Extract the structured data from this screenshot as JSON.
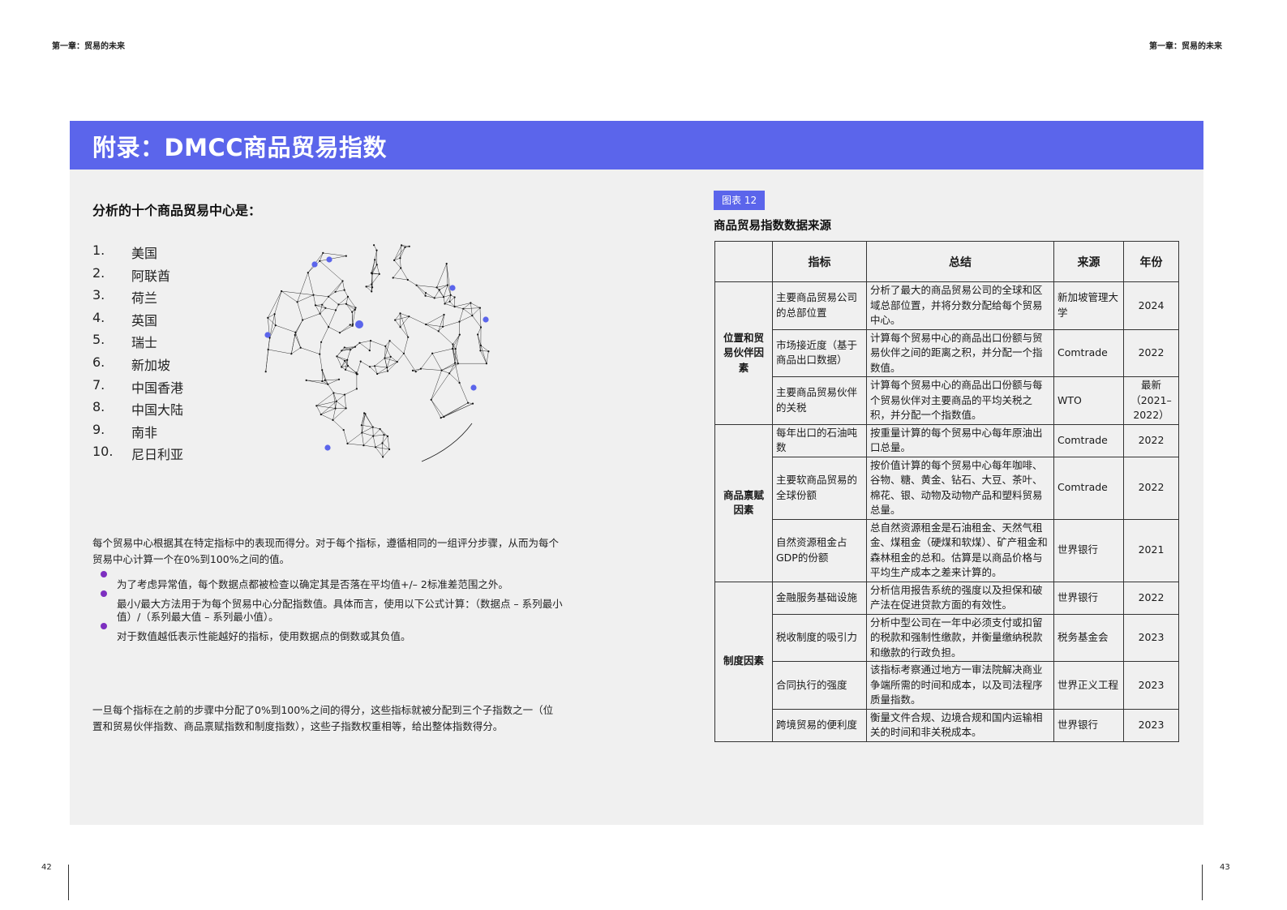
{
  "header": {
    "left_running": "第一章：贸易的未来",
    "right_running": "第一章：贸易的未来"
  },
  "banner": {
    "title": "附录：DMCC商品贸易指数"
  },
  "colors": {
    "accent": "#5b65eb",
    "bullet": "#7d2fc0",
    "panel": "#f0f0f0"
  },
  "left": {
    "subheading": "分析的十个商品贸易中心是：",
    "hubs": [
      {
        "num": "1.",
        "name": "美国"
      },
      {
        "num": "2.",
        "name": "阿联酋"
      },
      {
        "num": "3.",
        "name": "荷兰"
      },
      {
        "num": "4.",
        "name": "英国"
      },
      {
        "num": "5.",
        "name": "瑞士"
      },
      {
        "num": "6.",
        "name": "新加坡"
      },
      {
        "num": "7.",
        "name": "中国香港"
      },
      {
        "num": "8.",
        "name": "中国大陆"
      },
      {
        "num": "9.",
        "name": "南非"
      },
      {
        "num": "10.",
        "name": "尼日利亚"
      }
    ],
    "globe_icon": "wireframe-globe-icon",
    "intro": "每个贸易中心根据其在特定指标中的表现而得分。对于每个指标，遵循相同的一组评分步骤，从而为每个贸易中心计算一个在0%到100%之间的值。",
    "bullets": [
      "为了考虑异常值，每个数据点都被检查以确定其是否落在平均值+/– 2标准差范围之外。",
      "最小/最大方法用于为每个贸易中心分配指数值。具体而言，使用以下公式计算：（数据点 – 系列最小值）/（系列最大值 – 系列最小值）。",
      "对于数值越低表示性能越好的指标，使用数据点的倒数或其负值。"
    ],
    "closing": "一旦每个指标在之前的步骤中分配了0%到100%之间的得分，这些指标就被分配到三个子指数之一（位置和贸易伙伴指数、商品禀赋指数和制度指数），这些子指数权重相等，给出整体指数得分。"
  },
  "figure": {
    "tag": "图表 12",
    "title": "商品贸易指数数据来源",
    "columns": {
      "indicator": "指标",
      "summary": "总结",
      "source": "来源",
      "year": "年份"
    },
    "groups": [
      {
        "name": "位置和贸易伙伴因素",
        "rows": [
          {
            "indicator": "主要商品贸易公司的总部位置",
            "summary": "分析了最大的商品贸易公司的全球和区域总部位置，并将分数分配给每个贸易中心。",
            "source": "新加坡管理大学",
            "year": "2024"
          },
          {
            "indicator": "市场接近度（基于商品出口数据）",
            "summary": "计算每个贸易中心的商品出口份额与贸易伙伴之间的距离之积，并分配一个指数值。",
            "source": "Comtrade",
            "year": "2022"
          },
          {
            "indicator": "主要商品贸易伙伴的关税",
            "summary": "计算每个贸易中心的商品出口份额与每个贸易伙伴对主要商品的平均关税之积，并分配一个指数值。",
            "source": "WTO",
            "year": "最新（2021–2022）"
          }
        ]
      },
      {
        "name": "商品禀赋因素",
        "rows": [
          {
            "indicator": "每年出口的石油吨数",
            "summary": "按重量计算的每个贸易中心每年原油出口总量。",
            "source": "Comtrade",
            "year": "2022"
          },
          {
            "indicator": "主要软商品贸易的全球份额",
            "summary": "按价值计算的每个贸易中心每年咖啡、谷物、糖、黄金、钻石、大豆、茶叶、棉花、银、动物及动物产品和塑料贸易总量。",
            "source": "Comtrade",
            "year": "2022"
          },
          {
            "indicator": "自然资源租金占GDP的份额",
            "summary": "总自然资源租金是石油租金、天然气租金、煤租金（硬煤和软煤）、矿产租金和森林租金的总和。估算是以商品价格与平均生产成本之差来计算的。",
            "source": "世界银行",
            "year": "2021"
          }
        ]
      },
      {
        "name": "制度因素",
        "rows": [
          {
            "indicator": "金融服务基础设施",
            "summary": "分析信用报告系统的强度以及担保和破产法在促进贷款方面的有效性。",
            "source": "世界银行",
            "year": "2022"
          },
          {
            "indicator": "税收制度的吸引力",
            "summary": "分析中型公司在一年中必须支付或扣留的税款和强制性缴款，并衡量缴纳税款和缴款的行政负担。",
            "source": "税务基金会",
            "year": "2023"
          },
          {
            "indicator": "合同执行的强度",
            "summary": "该指标考察通过地方一审法院解决商业争端所需的时间和成本，以及司法程序质量指数。",
            "source": "世界正义工程",
            "year": "2023"
          },
          {
            "indicator": "跨境贸易的便利度",
            "summary": "衡量文件合规、边境合规和国内运输相关的时间和非关税成本。",
            "source": "世界银行",
            "year": "2023"
          }
        ]
      }
    ]
  },
  "footer": {
    "left_page": "42",
    "right_page": "43"
  }
}
